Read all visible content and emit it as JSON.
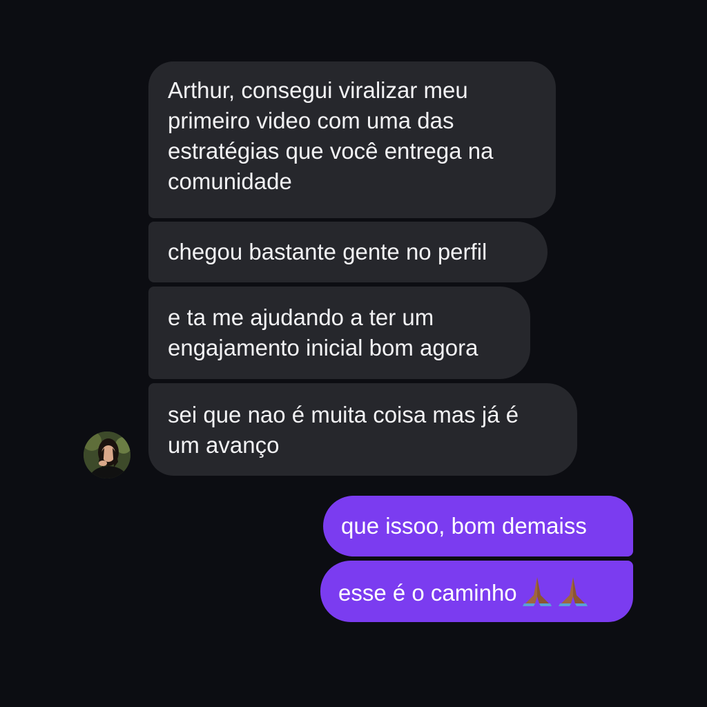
{
  "conversation": {
    "received": [
      {
        "lines": [
          "Arthur, consegui viralizar meu",
          "primeiro video com uma das",
          "estratégias que você entrega na",
          "comunidade"
        ]
      },
      {
        "lines": [
          "chegou bastante gente no perfil"
        ]
      },
      {
        "lines": [
          "e ta me ajudando a ter um",
          "engajamento inicial bom agora"
        ]
      },
      {
        "lines": [
          "sei que nao é muita coisa mas já é",
          "um avanço"
        ]
      }
    ],
    "sent": [
      {
        "text": "que issoo, bom demaiss"
      },
      {
        "text": "esse é o caminho",
        "emoji": [
          "praying-hands-icon",
          "praying-hands-icon"
        ]
      }
    ]
  },
  "colors": {
    "background": "#0c0d12",
    "received_bubble": "#26272c",
    "sent_bubble": "#7b3cf0",
    "text": "#f2f2f4"
  }
}
